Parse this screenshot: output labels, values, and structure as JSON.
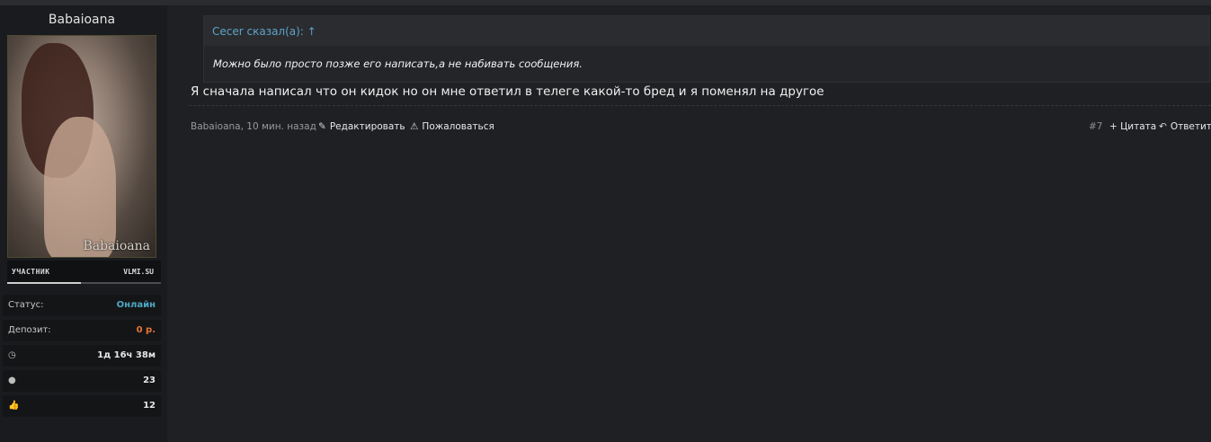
{
  "user": {
    "name": "Babaioana",
    "avatar_watermark": "Babaioana",
    "role": "УЧАСТНИК",
    "site": "VLMI.SU",
    "stats": [
      {
        "label": "Статус:",
        "value": "Онлайн",
        "color": "#4fa9c4"
      },
      {
        "label": "Депозит:",
        "value": "0 р.",
        "color": "#e6733a"
      },
      {
        "icon": "clock-icon",
        "value": "1д 16ч 38м"
      },
      {
        "icon": "comments-icon",
        "value": "23"
      },
      {
        "icon": "thumbs-up-icon",
        "value": "12"
      }
    ]
  },
  "quote": {
    "author": "Cecer сказал(а): ↑",
    "text": "Можно было просто позже его написать,а не набивать сообщения."
  },
  "post": {
    "message": "Я сначала написал что он кидок но он мне ответил в телеге какой-то бред и я поменял на другое",
    "meta": "Babaioana, 10 мин. назад",
    "edit_label": "Редактировать",
    "report_label": "Пожаловаться",
    "post_number": "#7",
    "quote_label": "+ Цитата",
    "reply_label": "Ответить"
  },
  "colors": {
    "background": "#1e2023",
    "sidebar": "#191b1e",
    "link": "#5fa3c9",
    "online": "#4fa9c4",
    "deposit": "#e6733a"
  }
}
